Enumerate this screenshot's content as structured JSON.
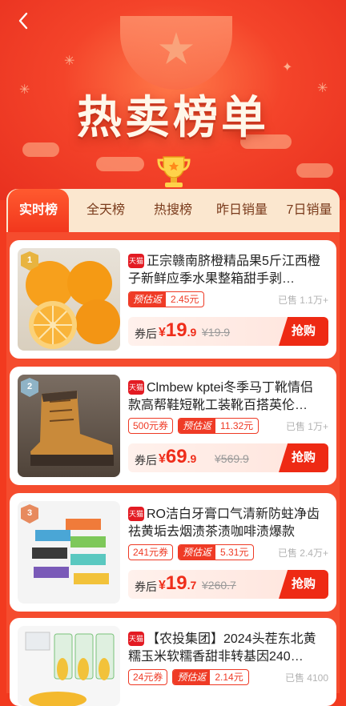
{
  "header": {
    "title": "热卖榜单",
    "back_icon": "chevron-left-icon"
  },
  "tabs": [
    {
      "label": "实时榜",
      "active": true
    },
    {
      "label": "全天榜",
      "active": false
    },
    {
      "label": "热搜榜",
      "active": false
    },
    {
      "label": "昨日销量",
      "active": false
    },
    {
      "label": "7日销量",
      "active": false
    }
  ],
  "colors": {
    "accent": "#ef2d1a",
    "tab_bg": "#fbe7cf",
    "badge_gold": "#e8b440",
    "badge_silver": "#8fb3c6",
    "badge_bronze": "#e78a5e"
  },
  "products": [
    {
      "rank": "1",
      "platform": "天猫",
      "title": "正宗赣南脐橙精品果5斤江西橙子新鲜应季水果整箱甜手剥…",
      "estimate_label": "预估返",
      "estimate_value": "2.45元",
      "coupon": "",
      "sold": "已售 1.1万+",
      "after_label": "券后",
      "price_yen": "¥",
      "price_int": "19",
      "price_dec": ".9",
      "original": "¥19.9",
      "buy": "抢购"
    },
    {
      "rank": "2",
      "platform": "天猫",
      "title": "Clmbew kptei冬季马丁靴情侣款高帮鞋短靴工装靴百搭英伦…",
      "estimate_label": "预估返",
      "estimate_value": "11.32元",
      "coupon": "500元券",
      "sold": "已售 1万+",
      "after_label": "券后",
      "price_yen": "¥",
      "price_int": "69",
      "price_dec": ".9",
      "original": "¥569.9",
      "buy": "抢购"
    },
    {
      "rank": "3",
      "platform": "天猫",
      "title": "RO洁白牙膏口气清新防蛀净齿祛黄垢去烟渍茶渍咖啡渍爆款",
      "estimate_label": "预估返",
      "estimate_value": "5.31元",
      "coupon": "241元券",
      "sold": "已售 2.4万+",
      "after_label": "券后",
      "price_yen": "¥",
      "price_int": "19",
      "price_dec": ".7",
      "original": "¥260.7",
      "buy": "抢购"
    },
    {
      "rank": "",
      "platform": "天猫",
      "title": "【农投集团】2024头茬东北黄糯玉米软糯香甜非转基因240…",
      "estimate_label": "预估返",
      "estimate_value": "2.14元",
      "coupon": "24元券",
      "sold": "已售 4100",
      "after_label": "",
      "price_yen": "",
      "price_int": "",
      "price_dec": "",
      "original": "",
      "buy": ""
    }
  ]
}
